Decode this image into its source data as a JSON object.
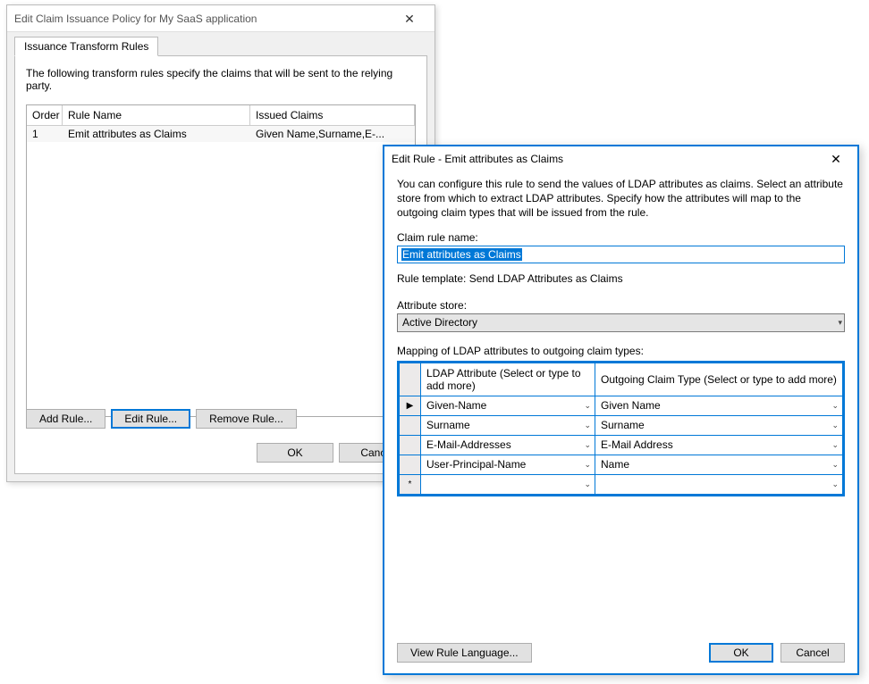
{
  "parentDialog": {
    "title": "Edit Claim Issuance Policy for My SaaS application",
    "tab": "Issuance Transform Rules",
    "description": "The following transform rules specify the claims that will be sent to the relying party.",
    "columns": {
      "order": "Order",
      "name": "Rule Name",
      "claims": "Issued Claims"
    },
    "rows": [
      {
        "order": "1",
        "name": "Emit attributes as Claims",
        "claims": "Given Name,Surname,E-..."
      }
    ],
    "buttons": {
      "add": "Add Rule...",
      "edit": "Edit Rule...",
      "remove": "Remove Rule...",
      "ok": "OK",
      "cancel": "Cancel"
    }
  },
  "editRuleDialog": {
    "title": "Edit Rule - Emit attributes as Claims",
    "instructions": "You can configure this rule to send the values of LDAP attributes as claims. Select an attribute store from which to extract LDAP attributes. Specify how the attributes will map to the outgoing claim types that will be issued from the rule.",
    "claimRuleNameLabel": "Claim rule name:",
    "claimRuleNameValue": "Emit attributes as Claims",
    "ruleTemplate": "Rule template: Send LDAP Attributes as Claims",
    "attributeStoreLabel": "Attribute store:",
    "attributeStoreValue": "Active Directory",
    "mappingLabel": "Mapping of LDAP attributes to outgoing claim types:",
    "mapHeaders": {
      "ldap": "LDAP Attribute (Select or type to add more)",
      "claim": "Outgoing Claim Type (Select or type to add more)"
    },
    "mappings": [
      {
        "ldap": "Given-Name",
        "claim": "Given Name",
        "marker": "▶"
      },
      {
        "ldap": "Surname",
        "claim": "Surname",
        "marker": ""
      },
      {
        "ldap": "E-Mail-Addresses",
        "claim": "E-Mail Address",
        "marker": ""
      },
      {
        "ldap": "User-Principal-Name",
        "claim": "Name",
        "marker": ""
      },
      {
        "ldap": "",
        "claim": "",
        "marker": "*"
      }
    ],
    "buttons": {
      "viewLang": "View Rule Language...",
      "ok": "OK",
      "cancel": "Cancel"
    }
  }
}
